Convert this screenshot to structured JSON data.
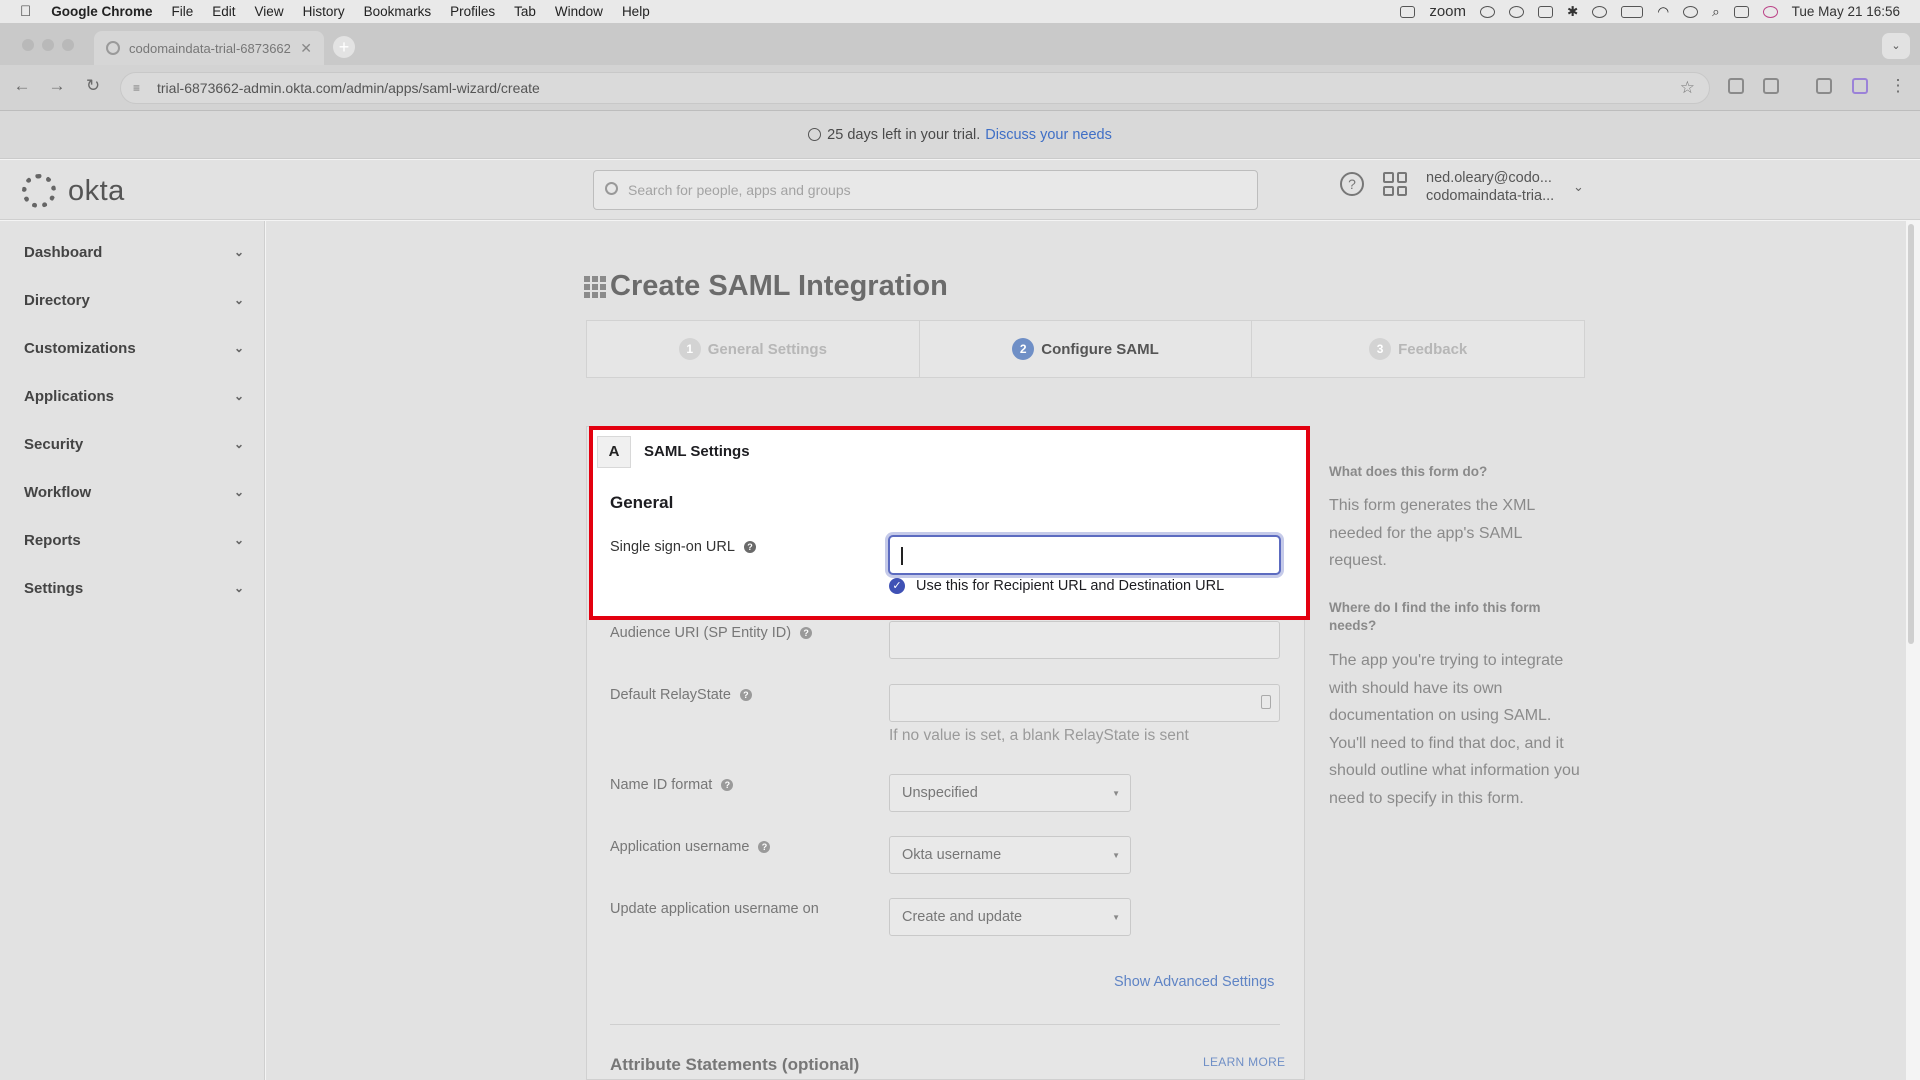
{
  "menubar": {
    "app": "Google Chrome",
    "items": [
      "File",
      "Edit",
      "View",
      "History",
      "Bookmarks",
      "Profiles",
      "Tab",
      "Window",
      "Help"
    ],
    "zoom_label": "zoom",
    "datetime": "Tue May 21  16:56"
  },
  "browser": {
    "tab_title": "codomaindata-trial-6873662",
    "url": "trial-6873662-admin.okta.com/admin/apps/saml-wizard/create"
  },
  "banner": {
    "text": "25 days left in your trial.",
    "link": "Discuss your needs"
  },
  "header": {
    "logo_text": "okta",
    "search_placeholder": "Search for people, apps and groups",
    "user_email": "ned.oleary@codo...",
    "user_org": "codomaindata-tria..."
  },
  "sidebar": {
    "items": [
      {
        "label": "Dashboard"
      },
      {
        "label": "Directory"
      },
      {
        "label": "Customizations"
      },
      {
        "label": "Applications"
      },
      {
        "label": "Security"
      },
      {
        "label": "Workflow"
      },
      {
        "label": "Reports"
      },
      {
        "label": "Settings"
      }
    ]
  },
  "page": {
    "title": "Create SAML Integration",
    "steps": [
      {
        "num": "1",
        "label": "General Settings"
      },
      {
        "num": "2",
        "label": "Configure SAML"
      },
      {
        "num": "3",
        "label": "Feedback"
      }
    ],
    "active_step": 2
  },
  "form": {
    "section_letter": "A",
    "section_title": "SAML Settings",
    "general_heading": "General",
    "sso_label": "Single sign-on URL",
    "sso_value": "",
    "use_for_recipient_label": "Use this for Recipient URL and Destination URL",
    "use_for_recipient_checked": true,
    "audience_label": "Audience URI (SP Entity ID)",
    "relay_label": "Default RelayState",
    "relay_hint": "If no value is set, a blank RelayState is sent",
    "nameid_label": "Name ID format",
    "nameid_value": "Unspecified",
    "appuser_label": "Application username",
    "appuser_value": "Okta username",
    "update_label": "Update application username on",
    "update_value": "Create and update",
    "advanced_link": "Show Advanced Settings",
    "attr_heading": "Attribute Statements (optional)",
    "learn_more": "LEARN MORE"
  },
  "help": {
    "q1": "What does this form do?",
    "a1": "This form generates the XML needed for the app's SAML request.",
    "q2": "Where do I find the info this form needs?",
    "a2": "The app you're trying to integrate with should have its own documentation on using SAML. You'll need to find that doc, and it should outline what information you need to specify in this form."
  },
  "colors": {
    "highlight_border": "#e3000f",
    "input_focus": "#5c6bc0",
    "link": "#3f6fc6"
  }
}
